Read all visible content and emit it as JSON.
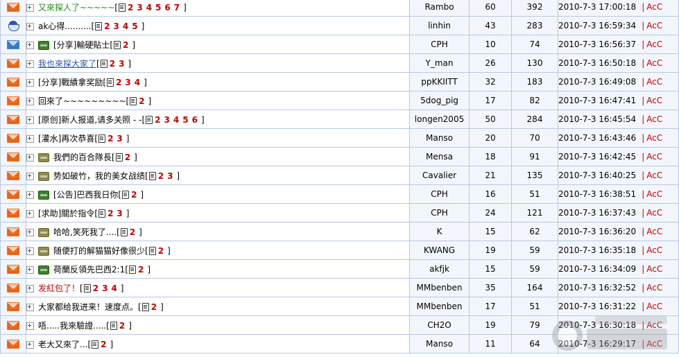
{
  "columns": [
    "icon",
    "title",
    "author",
    "replies",
    "views",
    "last_post"
  ],
  "rows": [
    {
      "icon": "orange-envelope",
      "tag": "",
      "title": "又來探人了~~~~~",
      "title_style": "green",
      "pages": [
        "2",
        "3",
        "4",
        "5",
        "6",
        "7"
      ],
      "author": "Rambo",
      "replies": "60",
      "views": "392",
      "last_time": "2010-7-3 17:00:18",
      "last_user": "AcC"
    },
    {
      "icon": "bot",
      "tag": "",
      "title": "ak心得..........",
      "title_style": "",
      "pages": [
        "2",
        "3",
        "4",
        "5"
      ],
      "author": "linhin",
      "replies": "43",
      "views": "283",
      "last_time": "2010-7-3 16:59:34",
      "last_user": "AcC"
    },
    {
      "icon": "blue-envelope",
      "tag": "green",
      "title": "[分享]輸硬貼士",
      "title_style": "",
      "pages": [
        "2"
      ],
      "author": "CPH",
      "replies": "10",
      "views": "74",
      "last_time": "2010-7-3 16:56:37",
      "last_user": "AcC"
    },
    {
      "icon": "orange-envelope",
      "tag": "",
      "title": "我也來探大家了",
      "title_style": "blue",
      "pages": [
        "2",
        "3"
      ],
      "author": "Y_man",
      "replies": "26",
      "views": "130",
      "last_time": "2010-7-3 16:50:18",
      "last_user": "AcC"
    },
    {
      "icon": "orange-envelope",
      "tag": "",
      "title": "[分享]戰績拿奖励",
      "title_style": "",
      "pages": [
        "2",
        "3",
        "4"
      ],
      "author": "ppKKIITT",
      "replies": "32",
      "views": "183",
      "last_time": "2010-7-3 16:49:08",
      "last_user": "AcC"
    },
    {
      "icon": "orange-envelope",
      "tag": "",
      "title": "回來了~~~~~~~~~",
      "title_style": "",
      "pages": [
        "2"
      ],
      "author": "5dog_pig",
      "replies": "17",
      "views": "82",
      "last_time": "2010-7-3 16:47:41",
      "last_user": "AcC"
    },
    {
      "icon": "orange-envelope",
      "tag": "",
      "title": "[原创]新人报道,请多关照 - -",
      "title_style": "",
      "pages": [
        "2",
        "3",
        "4",
        "5",
        "6"
      ],
      "author": "longen2005",
      "replies": "50",
      "views": "284",
      "last_time": "2010-7-3 16:45:54",
      "last_user": "AcC"
    },
    {
      "icon": "orange-envelope",
      "tag": "",
      "title": "[灌水]再次恭喜",
      "title_style": "",
      "pages": [
        "2",
        "3"
      ],
      "author": "Manso",
      "replies": "20",
      "views": "70",
      "last_time": "2010-7-3 16:43:46",
      "last_user": "AcC"
    },
    {
      "icon": "orange-envelope",
      "tag": "olive",
      "title": "我們的百合隊長",
      "title_style": "",
      "pages": [
        "2"
      ],
      "author": "Mensa",
      "replies": "18",
      "views": "91",
      "last_time": "2010-7-3 16:42:45",
      "last_user": "AcC"
    },
    {
      "icon": "orange-envelope",
      "tag": "olive",
      "title": "势如破竹，我的美女战绩",
      "title_style": "",
      "pages": [
        "2",
        "3"
      ],
      "author": "Cavalier",
      "replies": "21",
      "views": "135",
      "last_time": "2010-7-3 16:40:25",
      "last_user": "AcC"
    },
    {
      "icon": "orange-envelope",
      "tag": "green",
      "title": "[公告]巴西我日你",
      "title_style": "",
      "pages": [
        "2"
      ],
      "author": "CPH",
      "replies": "16",
      "views": "51",
      "last_time": "2010-7-3 16:38:51",
      "last_user": "AcC"
    },
    {
      "icon": "orange-envelope",
      "tag": "",
      "title": "[求助]關於指令",
      "title_style": "",
      "pages": [
        "2",
        "3"
      ],
      "author": "CPH",
      "replies": "24",
      "views": "121",
      "last_time": "2010-7-3 16:37:43",
      "last_user": "AcC"
    },
    {
      "icon": "orange-envelope",
      "tag": "olive",
      "title": "哈哈,笑死我了....",
      "title_style": "",
      "pages": [
        "2"
      ],
      "author": "K",
      "replies": "15",
      "views": "62",
      "last_time": "2010-7-3 16:36:20",
      "last_user": "AcC"
    },
    {
      "icon": "orange-envelope",
      "tag": "olive",
      "title": "随便打的解猫猫好像很少",
      "title_style": "",
      "pages": [
        "2"
      ],
      "author": "KWANG",
      "replies": "19",
      "views": "59",
      "last_time": "2010-7-3 16:35:18",
      "last_user": "AcC"
    },
    {
      "icon": "orange-envelope",
      "tag": "green",
      "title": "荷蘭反領先巴西2:1",
      "title_style": "",
      "pages": [
        "2"
      ],
      "author": "akfjk",
      "replies": "15",
      "views": "59",
      "last_time": "2010-7-3 16:34:09",
      "last_user": "AcC"
    },
    {
      "icon": "orange-envelope",
      "tag": "",
      "title": "发紅包了！",
      "title_style": "red",
      "pages": [
        "2",
        "3",
        "4"
      ],
      "author": "MMbenben",
      "replies": "35",
      "views": "164",
      "last_time": "2010-7-3 16:32:52",
      "last_user": "AcC"
    },
    {
      "icon": "orange-envelope",
      "tag": "",
      "title": "大家都给我进来！速度点。",
      "title_style": "",
      "pages": [
        "2"
      ],
      "author": "MMbenben",
      "replies": "17",
      "views": "51",
      "last_time": "2010-7-3 16:31:22",
      "last_user": "AcC"
    },
    {
      "icon": "orange-envelope",
      "tag": "",
      "title": "唔.....我來驗證.....",
      "title_style": "",
      "pages": [
        "2"
      ],
      "author": "CH2O",
      "replies": "19",
      "views": "79",
      "last_time": "2010-7-3 16:30:18",
      "last_user": "AcC"
    },
    {
      "icon": "orange-envelope",
      "tag": "",
      "title": "老大又來了...",
      "title_style": "",
      "pages": [
        "2"
      ],
      "author": "Manso",
      "replies": "11",
      "views": "64",
      "last_time": "2010-7-3 16:29:17",
      "last_user": "AcC"
    }
  ],
  "last_sep": "|",
  "colors": {
    "border": "#b7c7e0",
    "alt_bg": "#f2f6fc",
    "accent_red": "#c00000",
    "green_title": "#1a8a1a",
    "blue_title": "#2a55a8"
  }
}
